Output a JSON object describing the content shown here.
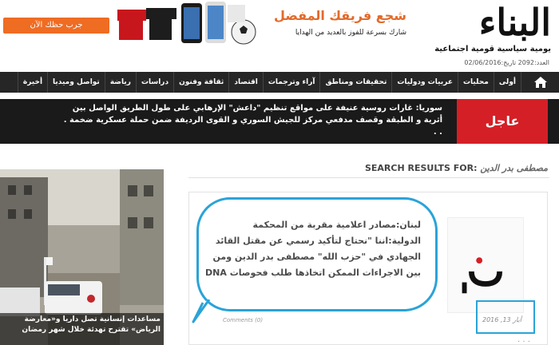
{
  "header": {
    "logo": "البناء",
    "tagline": "يومية سياسية قومية اجتماعية",
    "issue": "العدد:2092 تاريخ:02/06/2016"
  },
  "ad": {
    "title": "شجع فريقك المفضل",
    "subtitle": "شارك بسرعة للفوز بالعديد من الهدايا",
    "button": "جرب حظك الآن",
    "colors": {
      "accent": "#ef6c23"
    }
  },
  "nav": {
    "home_icon": "home-icon",
    "items": [
      "أولى",
      "محليات",
      "عربيات ودوليات",
      "تحقيقات ومناطق",
      "آراء وترجمات",
      "اقتصاد",
      "ثقافة وفنون",
      "دراسات",
      "رياضة",
      "تواصل وميديا",
      "أخيرة"
    ]
  },
  "breaking": {
    "label": "عاجل",
    "text": "سوريا: غارات روسية عنيفة على مواقع تنظيم \"داعش\" الإرهابي على طول الطريق الواصل بين أثرية و الطبقة وقصف مدفعي مركز للجيش السوري و القوى الرديفة ضمن حملة عسكرية ضخمة . . ."
  },
  "search": {
    "prefix": "SEARCH RESULTS FOR:",
    "query": "مصطفى بدر الدين"
  },
  "photo": {
    "caption": "مساعدات إنسانية تصل داريا و«معارضة الرياض» تقترح تهدئة خلال شهر رمضان"
  },
  "article": {
    "text": "لبنان:مصادر اعلامية مقربة من المحكمة الدولية:اننا \"نحتاج لتأكيد رسمي عن مقتل القائد الجهادي في \"حزب الله\" مصطفى بدر الدين ومن بين الاجراءات الممكن اتخاذها طلب فحوصات DNA",
    "date": "أيار 13, 2016",
    "comments": "Comments (0)",
    "more": ". . ."
  }
}
